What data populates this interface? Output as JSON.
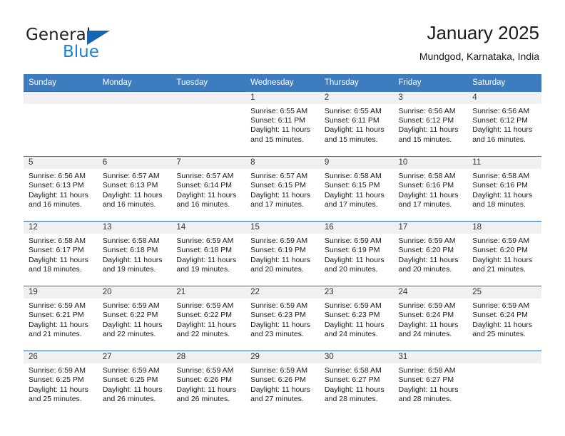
{
  "brand": {
    "name_part1": "General",
    "name_part2": "Blue",
    "logo_icon": "triangle-flag-icon"
  },
  "header": {
    "title": "January 2025",
    "subtitle": "Mundgod, Karnataka, India"
  },
  "calendar": {
    "weekday_headers": [
      "Sunday",
      "Monday",
      "Tuesday",
      "Wednesday",
      "Thursday",
      "Friday",
      "Saturday"
    ],
    "accent_color": "#3d7cbf",
    "grid_line_color": "#2f6caf",
    "daynum_band_color": "#f0f0f0",
    "leading_blanks": 3,
    "weeks": [
      [
        {
          "day": "",
          "sunrise": "",
          "sunset": "",
          "daylight_line1": "",
          "daylight_line2": ""
        },
        {
          "day": "",
          "sunrise": "",
          "sunset": "",
          "daylight_line1": "",
          "daylight_line2": ""
        },
        {
          "day": "",
          "sunrise": "",
          "sunset": "",
          "daylight_line1": "",
          "daylight_line2": ""
        },
        {
          "day": "1",
          "sunrise": "Sunrise: 6:55 AM",
          "sunset": "Sunset: 6:11 PM",
          "daylight_line1": "Daylight: 11 hours",
          "daylight_line2": "and 15 minutes."
        },
        {
          "day": "2",
          "sunrise": "Sunrise: 6:55 AM",
          "sunset": "Sunset: 6:11 PM",
          "daylight_line1": "Daylight: 11 hours",
          "daylight_line2": "and 15 minutes."
        },
        {
          "day": "3",
          "sunrise": "Sunrise: 6:56 AM",
          "sunset": "Sunset: 6:12 PM",
          "daylight_line1": "Daylight: 11 hours",
          "daylight_line2": "and 15 minutes."
        },
        {
          "day": "4",
          "sunrise": "Sunrise: 6:56 AM",
          "sunset": "Sunset: 6:12 PM",
          "daylight_line1": "Daylight: 11 hours",
          "daylight_line2": "and 16 minutes."
        }
      ],
      [
        {
          "day": "5",
          "sunrise": "Sunrise: 6:56 AM",
          "sunset": "Sunset: 6:13 PM",
          "daylight_line1": "Daylight: 11 hours",
          "daylight_line2": "and 16 minutes."
        },
        {
          "day": "6",
          "sunrise": "Sunrise: 6:57 AM",
          "sunset": "Sunset: 6:13 PM",
          "daylight_line1": "Daylight: 11 hours",
          "daylight_line2": "and 16 minutes."
        },
        {
          "day": "7",
          "sunrise": "Sunrise: 6:57 AM",
          "sunset": "Sunset: 6:14 PM",
          "daylight_line1": "Daylight: 11 hours",
          "daylight_line2": "and 16 minutes."
        },
        {
          "day": "8",
          "sunrise": "Sunrise: 6:57 AM",
          "sunset": "Sunset: 6:15 PM",
          "daylight_line1": "Daylight: 11 hours",
          "daylight_line2": "and 17 minutes."
        },
        {
          "day": "9",
          "sunrise": "Sunrise: 6:58 AM",
          "sunset": "Sunset: 6:15 PM",
          "daylight_line1": "Daylight: 11 hours",
          "daylight_line2": "and 17 minutes."
        },
        {
          "day": "10",
          "sunrise": "Sunrise: 6:58 AM",
          "sunset": "Sunset: 6:16 PM",
          "daylight_line1": "Daylight: 11 hours",
          "daylight_line2": "and 17 minutes."
        },
        {
          "day": "11",
          "sunrise": "Sunrise: 6:58 AM",
          "sunset": "Sunset: 6:16 PM",
          "daylight_line1": "Daylight: 11 hours",
          "daylight_line2": "and 18 minutes."
        }
      ],
      [
        {
          "day": "12",
          "sunrise": "Sunrise: 6:58 AM",
          "sunset": "Sunset: 6:17 PM",
          "daylight_line1": "Daylight: 11 hours",
          "daylight_line2": "and 18 minutes."
        },
        {
          "day": "13",
          "sunrise": "Sunrise: 6:58 AM",
          "sunset": "Sunset: 6:18 PM",
          "daylight_line1": "Daylight: 11 hours",
          "daylight_line2": "and 19 minutes."
        },
        {
          "day": "14",
          "sunrise": "Sunrise: 6:59 AM",
          "sunset": "Sunset: 6:18 PM",
          "daylight_line1": "Daylight: 11 hours",
          "daylight_line2": "and 19 minutes."
        },
        {
          "day": "15",
          "sunrise": "Sunrise: 6:59 AM",
          "sunset": "Sunset: 6:19 PM",
          "daylight_line1": "Daylight: 11 hours",
          "daylight_line2": "and 20 minutes."
        },
        {
          "day": "16",
          "sunrise": "Sunrise: 6:59 AM",
          "sunset": "Sunset: 6:19 PM",
          "daylight_line1": "Daylight: 11 hours",
          "daylight_line2": "and 20 minutes."
        },
        {
          "day": "17",
          "sunrise": "Sunrise: 6:59 AM",
          "sunset": "Sunset: 6:20 PM",
          "daylight_line1": "Daylight: 11 hours",
          "daylight_line2": "and 20 minutes."
        },
        {
          "day": "18",
          "sunrise": "Sunrise: 6:59 AM",
          "sunset": "Sunset: 6:20 PM",
          "daylight_line1": "Daylight: 11 hours",
          "daylight_line2": "and 21 minutes."
        }
      ],
      [
        {
          "day": "19",
          "sunrise": "Sunrise: 6:59 AM",
          "sunset": "Sunset: 6:21 PM",
          "daylight_line1": "Daylight: 11 hours",
          "daylight_line2": "and 21 minutes."
        },
        {
          "day": "20",
          "sunrise": "Sunrise: 6:59 AM",
          "sunset": "Sunset: 6:22 PM",
          "daylight_line1": "Daylight: 11 hours",
          "daylight_line2": "and 22 minutes."
        },
        {
          "day": "21",
          "sunrise": "Sunrise: 6:59 AM",
          "sunset": "Sunset: 6:22 PM",
          "daylight_line1": "Daylight: 11 hours",
          "daylight_line2": "and 22 minutes."
        },
        {
          "day": "22",
          "sunrise": "Sunrise: 6:59 AM",
          "sunset": "Sunset: 6:23 PM",
          "daylight_line1": "Daylight: 11 hours",
          "daylight_line2": "and 23 minutes."
        },
        {
          "day": "23",
          "sunrise": "Sunrise: 6:59 AM",
          "sunset": "Sunset: 6:23 PM",
          "daylight_line1": "Daylight: 11 hours",
          "daylight_line2": "and 24 minutes."
        },
        {
          "day": "24",
          "sunrise": "Sunrise: 6:59 AM",
          "sunset": "Sunset: 6:24 PM",
          "daylight_line1": "Daylight: 11 hours",
          "daylight_line2": "and 24 minutes."
        },
        {
          "day": "25",
          "sunrise": "Sunrise: 6:59 AM",
          "sunset": "Sunset: 6:24 PM",
          "daylight_line1": "Daylight: 11 hours",
          "daylight_line2": "and 25 minutes."
        }
      ],
      [
        {
          "day": "26",
          "sunrise": "Sunrise: 6:59 AM",
          "sunset": "Sunset: 6:25 PM",
          "daylight_line1": "Daylight: 11 hours",
          "daylight_line2": "and 25 minutes."
        },
        {
          "day": "27",
          "sunrise": "Sunrise: 6:59 AM",
          "sunset": "Sunset: 6:25 PM",
          "daylight_line1": "Daylight: 11 hours",
          "daylight_line2": "and 26 minutes."
        },
        {
          "day": "28",
          "sunrise": "Sunrise: 6:59 AM",
          "sunset": "Sunset: 6:26 PM",
          "daylight_line1": "Daylight: 11 hours",
          "daylight_line2": "and 26 minutes."
        },
        {
          "day": "29",
          "sunrise": "Sunrise: 6:59 AM",
          "sunset": "Sunset: 6:26 PM",
          "daylight_line1": "Daylight: 11 hours",
          "daylight_line2": "and 27 minutes."
        },
        {
          "day": "30",
          "sunrise": "Sunrise: 6:58 AM",
          "sunset": "Sunset: 6:27 PM",
          "daylight_line1": "Daylight: 11 hours",
          "daylight_line2": "and 28 minutes."
        },
        {
          "day": "31",
          "sunrise": "Sunrise: 6:58 AM",
          "sunset": "Sunset: 6:27 PM",
          "daylight_line1": "Daylight: 11 hours",
          "daylight_line2": "and 28 minutes."
        },
        {
          "day": "",
          "sunrise": "",
          "sunset": "",
          "daylight_line1": "",
          "daylight_line2": ""
        }
      ]
    ]
  }
}
